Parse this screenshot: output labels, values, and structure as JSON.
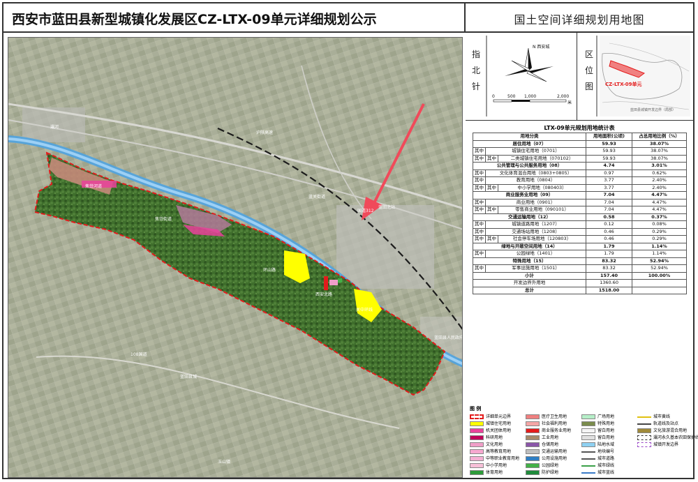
{
  "header": {
    "title": "西安市蓝田县新型城镇化发展区CZ-LTX-09单元详细规划公示",
    "subtitle": "国土空间详细规划用地图"
  },
  "map": {
    "place_labels": [
      {
        "id": "lbl-1",
        "text": "焦岱河道"
      },
      {
        "id": "lbl-2",
        "text": "焦岱街道"
      },
      {
        "id": "lbl-3",
        "text": "环山路"
      },
      {
        "id": "lbl-4",
        "text": "西安北路"
      },
      {
        "id": "lbl-5",
        "text": "关中环线"
      },
      {
        "id": "lbl-6",
        "text": "蓝田县人民政府"
      },
      {
        "id": "lbl-7",
        "text": "沪陕高速"
      },
      {
        "id": "lbl-8",
        "text": "108国道"
      },
      {
        "id": "lbl-9",
        "text": "国道312"
      },
      {
        "id": "lbl-10",
        "text": "蓝田北站"
      },
      {
        "id": "lbl-11",
        "text": "蓝关街道"
      },
      {
        "id": "lbl-12",
        "text": "灞河"
      },
      {
        "id": "lbl-13",
        "text": "蓝田县城"
      },
      {
        "id": "lbl-14",
        "text": "玉山镇"
      }
    ]
  },
  "north_arrow": {
    "side_label": [
      "指",
      "北",
      "针"
    ],
    "n_label": "N 西安城",
    "scale_ticks": [
      "0",
      "500",
      "1,000",
      "2,000"
    ],
    "scale_unit": "米"
  },
  "location": {
    "side_label": [
      "区",
      "位",
      "图"
    ],
    "unit_label": "CZ-LTX-09单元",
    "caption": "蓝田县城镇开发边界（局部）"
  },
  "stats_table": {
    "title": "LTX-09单元规划用地统计表",
    "headers": [
      "用地分类",
      "用地面积(公顷)",
      "占总用地比例（%）"
    ],
    "rows": [
      {
        "group": "",
        "sub": "",
        "name": "居住用地（07）",
        "area": "59.93",
        "pct": "38.07%",
        "bold": true
      },
      {
        "group": "其中",
        "sub": "",
        "name": "城镇住宅用地（0701）",
        "area": "59.93",
        "pct": "38.07%",
        "bold": false
      },
      {
        "group": "其中",
        "sub": "其中",
        "name": "二类城镇住宅用地（070102）",
        "area": "59.93",
        "pct": "38.07%",
        "bold": false
      },
      {
        "group": "",
        "sub": "",
        "name": "公共管理与公共服务用地（08）",
        "area": "4.74",
        "pct": "3.01%",
        "bold": true
      },
      {
        "group": "其中",
        "sub": "",
        "name": "文化体育混合用地（0803+0805）",
        "area": "0.97",
        "pct": "0.62%",
        "bold": false
      },
      {
        "group": "其中",
        "sub": "",
        "name": "教育用地（0804）",
        "area": "3.77",
        "pct": "2.40%",
        "bold": false
      },
      {
        "group": "其中",
        "sub": "其中",
        "name": "中小学用地（080403）",
        "area": "3.77",
        "pct": "2.40%",
        "bold": false
      },
      {
        "group": "",
        "sub": "",
        "name": "商业服务业用地（09）",
        "area": "7.04",
        "pct": "4.47%",
        "bold": true
      },
      {
        "group": "其中",
        "sub": "",
        "name": "商业用地（0901）",
        "area": "7.04",
        "pct": "4.47%",
        "bold": false
      },
      {
        "group": "其中",
        "sub": "其中",
        "name": "零售商业用地（090101）",
        "area": "7.04",
        "pct": "4.47%",
        "bold": false
      },
      {
        "group": "",
        "sub": "",
        "name": "交通运输用地（12）",
        "area": "0.58",
        "pct": "0.37%",
        "bold": true
      },
      {
        "group": "其中",
        "sub": "",
        "name": "城镇道路用地（1207）",
        "area": "0.12",
        "pct": "0.08%",
        "bold": false
      },
      {
        "group": "其中",
        "sub": "",
        "name": "交通场站用地（1208）",
        "area": "0.46",
        "pct": "0.29%",
        "bold": false
      },
      {
        "group": "其中",
        "sub": "其中",
        "name": "社会停车场用地（120803）",
        "area": "0.46",
        "pct": "0.29%",
        "bold": false
      },
      {
        "group": "",
        "sub": "",
        "name": "绿地与开敞空间用地（14）",
        "area": "1.79",
        "pct": "1.14%",
        "bold": true
      },
      {
        "group": "其中",
        "sub": "",
        "name": "公园绿地（1401）",
        "area": "1.79",
        "pct": "1.14%",
        "bold": false
      },
      {
        "group": "",
        "sub": "",
        "name": "特殊用地（15）",
        "area": "83.32",
        "pct": "52.94%",
        "bold": true
      },
      {
        "group": "其中",
        "sub": "",
        "name": "军事设施用地（1501）",
        "area": "83.32",
        "pct": "52.94%",
        "bold": false
      },
      {
        "group": "",
        "sub": "",
        "name": "小计",
        "area": "157.40",
        "pct": "100.00%",
        "bold": true
      },
      {
        "group": "",
        "sub": "",
        "name": "开发边界外用地",
        "area": "1360.60",
        "pct": "",
        "bold": false
      },
      {
        "group": "",
        "sub": "",
        "name": "总计",
        "area": "1518.00",
        "pct": "",
        "bold": true
      }
    ]
  },
  "legend": {
    "title": "图  例",
    "items": [
      {
        "label": "详细单元边界",
        "color": "#ffffff",
        "type": "dash-red"
      },
      {
        "label": "城镇住宅用地",
        "color": "#ffff00",
        "type": "fill"
      },
      {
        "label": "机关团体用地",
        "color": "#e9429b",
        "type": "fill"
      },
      {
        "label": "科研用地",
        "color": "#c0005a",
        "type": "fill"
      },
      {
        "label": "文化用地",
        "color": "#f09ec8",
        "type": "fill"
      },
      {
        "label": "高等教育用地",
        "color": "#f7a8d0",
        "type": "fill"
      },
      {
        "label": "中等职业教育用地",
        "color": "#f5b0d4",
        "type": "fill"
      },
      {
        "label": "中小学用地",
        "color": "#f7c0d8",
        "type": "fill"
      },
      {
        "label": "体育用地",
        "color": "#2e9c3a",
        "type": "fill"
      },
      {
        "label": "医疗卫生用地",
        "color": "#f08080",
        "type": "fill"
      },
      {
        "label": "社会福利用地",
        "color": "#f4a6a6",
        "type": "fill"
      },
      {
        "label": "商业服务业用地",
        "color": "#e31c1c",
        "type": "fill"
      },
      {
        "label": "工业用地",
        "color": "#a68b6b",
        "type": "fill"
      },
      {
        "label": "仓储用地",
        "color": "#8a55a8",
        "type": "fill"
      },
      {
        "label": "交通运输用地",
        "color": "#bfbfbf",
        "type": "fill"
      },
      {
        "label": "公用设施用地",
        "color": "#2e7ec4",
        "type": "fill"
      },
      {
        "label": "公园绿地",
        "color": "#43b047",
        "type": "fill"
      },
      {
        "label": "防护绿地",
        "color": "#1f8a3b",
        "type": "fill"
      },
      {
        "label": "广场用地",
        "color": "#b6efc8",
        "type": "fill"
      },
      {
        "label": "特殊用地",
        "color": "#7a8c4c",
        "type": "fill"
      },
      {
        "label": "留白用地",
        "color": "#f4f4f4",
        "type": "fill"
      },
      {
        "label": "留白用地",
        "color": "#e0e0e0",
        "type": "fill"
      },
      {
        "label": "陆地水域",
        "color": "#8fd1f2",
        "type": "fill"
      },
      {
        "label": "地块编号",
        "color": "#ffffff",
        "type": "line"
      },
      {
        "label": "城市道路",
        "color": "#ffffff",
        "type": "line"
      },
      {
        "label": "城市绿线",
        "color": "#3aa048",
        "type": "line"
      },
      {
        "label": "城市蓝线",
        "color": "#3a7ac8",
        "type": "line"
      },
      {
        "label": "城市黄线",
        "color": "#e0c010",
        "type": "line"
      },
      {
        "label": "轨道线及站点",
        "color": "#444444",
        "type": "line"
      },
      {
        "label": "文化旅游混合用地",
        "color": "#a08a3a",
        "type": "fill"
      },
      {
        "label": "灞河永久基本农田保护线",
        "color": "#ffffff",
        "type": "dash-dark"
      },
      {
        "label": "城镇开发边界",
        "color": "#ffffff",
        "type": "dash-purple"
      }
    ]
  },
  "colors": {
    "boundary": "#e31c1c",
    "river": "#4fa3e0",
    "forest": "#3c6b2a",
    "farmland": "#a8ad96"
  }
}
